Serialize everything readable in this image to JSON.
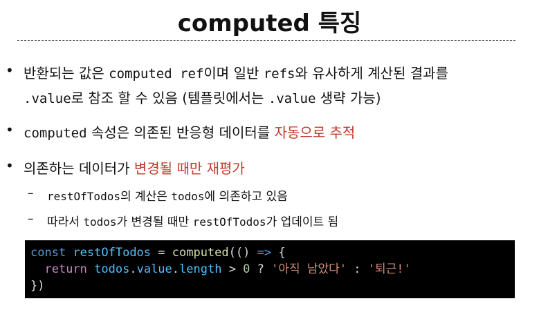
{
  "title": "computed 특징",
  "bullets": [
    {
      "line1": [
        {
          "t": "반환되는 값은 "
        },
        {
          "t": "computed ref",
          "mono": true
        },
        {
          "t": "이며 일반 "
        },
        {
          "t": "refs",
          "mono": true
        },
        {
          "t": "와 유사하게 계산된 결과를"
        }
      ],
      "line2": [
        {
          "t": ".value",
          "mono": true
        },
        {
          "t": "로 참조 할 수 있음 (템플릿에서는 "
        },
        {
          "t": ".value",
          "mono": true
        },
        {
          "t": " 생략 가능)"
        }
      ]
    },
    {
      "line1": [
        {
          "t": "computed",
          "mono": true
        },
        {
          "t": " 속성은 의존된 반응형 데이터를 "
        },
        {
          "t": "자동으로 추적",
          "red": true
        }
      ]
    },
    {
      "line1": [
        {
          "t": "의존하는 데이터가 "
        },
        {
          "t": "변경될 때만 재평가",
          "red": true
        }
      ]
    }
  ],
  "sub_bullets": [
    [
      {
        "t": "restOfTodos",
        "mono": true
      },
      {
        "t": "의 계산은 "
      },
      {
        "t": "todos",
        "mono": true
      },
      {
        "t": "에 의존하고 있음"
      }
    ],
    [
      {
        "t": "따라서 "
      },
      {
        "t": "todos",
        "mono": true
      },
      {
        "t": "가 변경될 때만 "
      },
      {
        "t": "restOfTodos",
        "mono": true
      },
      {
        "t": "가 업데이트 됨"
      }
    ]
  ],
  "bullet_char": "•",
  "dash_char": "–",
  "code": {
    "l1": [
      "const",
      " ",
      "restOfTodos",
      " = ",
      "computed",
      "(() ",
      "=>",
      " {"
    ],
    "l2": [
      "  ",
      "return",
      " ",
      "todos",
      ".",
      "value",
      ".",
      "length",
      " > ",
      "0",
      " ? ",
      "'아직 남았다'",
      " : ",
      "'퇴근!'"
    ],
    "l3": "})"
  }
}
